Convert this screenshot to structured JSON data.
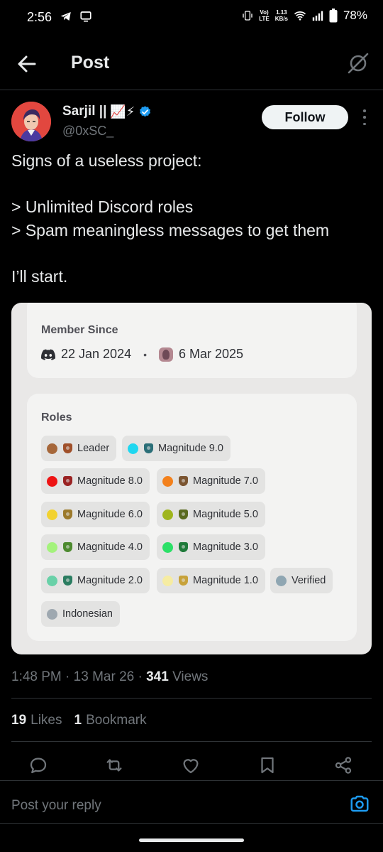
{
  "status_bar": {
    "time": "2:56",
    "lte_label": "LTE",
    "network_speed": "1.13",
    "network_unit": "KB/s",
    "battery": "78%"
  },
  "header": {
    "title": "Post"
  },
  "author": {
    "name": "Sarjil ||",
    "emoji": "📈⚡",
    "handle": "@0xSC_",
    "follow_label": "Follow"
  },
  "tweet": {
    "text": "Signs of a useless project:\n\n> Unlimited Discord roles\n> Spam meaningless messages to get them\n\nI’ll start."
  },
  "media": {
    "member_since_label": "Member Since",
    "discord_join_date": "22 Jan 2024",
    "date_separator": "•",
    "server_join_date": "6 Mar 2025",
    "roles_label": "Roles",
    "roles": [
      {
        "label": "Leader",
        "color": "#a6673a",
        "emblem_color": "#a0502a"
      },
      {
        "label": "Magnitude 9.0",
        "color": "#1fd7f0",
        "emblem_color": "#2b6f78"
      },
      {
        "label": "Magnitude 8.0",
        "color": "#ee1414",
        "emblem_color": "#9a2323"
      },
      {
        "label": "Magnitude 7.0",
        "color": "#f3811c",
        "emblem_color": "#7b5531"
      },
      {
        "label": "Magnitude 6.0",
        "color": "#f2d230",
        "emblem_color": "#9c7a2b"
      },
      {
        "label": "Magnitude 5.0",
        "color": "#9fb51c",
        "emblem_color": "#5a6a1f"
      },
      {
        "label": "Magnitude 4.0",
        "color": "#a4f27c",
        "emblem_color": "#4d8a2f"
      },
      {
        "label": "Magnitude 3.0",
        "color": "#2be067",
        "emblem_color": "#1f7a3a"
      },
      {
        "label": "Magnitude 2.0",
        "color": "#69d1a8",
        "emblem_color": "#2b7d61"
      },
      {
        "label": "Magnitude 1.0",
        "color": "#f6eca2",
        "emblem_color": "#c7a23a"
      },
      {
        "label": "Verified",
        "color": "#8fa6b2",
        "emblem_color": ""
      },
      {
        "label": "Indonesian",
        "color": "#9ea8b0",
        "emblem_color": ""
      }
    ]
  },
  "meta": {
    "time": "1:48 PM",
    "date": "13 Mar 26",
    "views_count": "341",
    "views_label": "Views"
  },
  "stats": {
    "likes_count": "19",
    "likes_label": "Likes",
    "bookmarks_count": "1",
    "bookmarks_label": "Bookmark"
  },
  "reply": {
    "placeholder": "Post your reply"
  },
  "colors": {
    "accent": "#1d9bf0",
    "verified": "#1d9bf0",
    "avatar_bg": "#e2473f",
    "card_bg": "#e9e8e7"
  },
  "icons": [
    "back-arrow-icon",
    "grok-icon",
    "verified-badge-icon",
    "more-icon",
    "discord-icon",
    "reply-icon",
    "repost-icon",
    "like-icon",
    "bookmark-icon",
    "share-icon",
    "camera-icon"
  ]
}
